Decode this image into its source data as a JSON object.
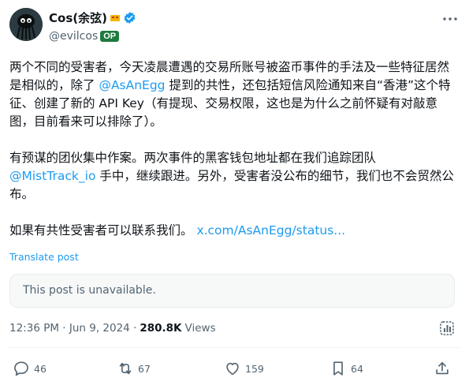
{
  "author": {
    "display_name": "Cos(余弦)",
    "handle": "@evilcos",
    "badge": "OP",
    "verified_color": "#1d9bf0",
    "avatar_icon": "spider-avatar-icon"
  },
  "post": {
    "paragraph1_a": "两个不同的受害者，今天凌晨遭遇的交易所账号被盗币事件的手法及一些特征居然是相似的，除了 ",
    "paragraph1_mention": "@AsAnEgg",
    "paragraph1_b": " 提到的共性，还包括短信风险通知来自“香港”这个特征、创建了新的 API Key（有提现、交易权限，这也是为什么之前怀疑有对敲意图，目前看来可以排除了）。",
    "paragraph2_a": "有预谋的团伙集中作案。两次事件的黑客钱包地址都在我们追踪团队 ",
    "paragraph2_mention": "@MistTrack_io",
    "paragraph2_b": " 手中，继续跟进。另外，受害者没公布的细节，我们也不会贸然公布。",
    "paragraph3_a": "如果有共性受害者可以联系我们。 ",
    "paragraph3_link": "x.com/AsAnEgg/status...",
    "translate_label": "Translate post"
  },
  "quoted": {
    "unavailable_text": "This post is unavailable."
  },
  "meta": {
    "timestamp": "12:36 PM · Jun 9, 2024 · ",
    "views_count": "280.8K",
    "views_label": "Views"
  },
  "actions": {
    "replies": "46",
    "reposts": "67",
    "likes": "159",
    "bookmarks": "64"
  },
  "colors": {
    "link": "#1d9bf0",
    "muted": "#536471",
    "text": "#0f1419",
    "op_badge": "#1f7a3e"
  }
}
